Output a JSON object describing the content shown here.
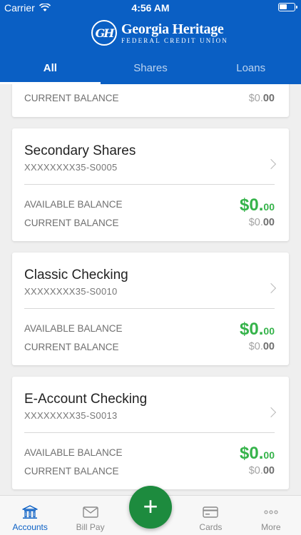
{
  "status": {
    "carrier": "Carrier",
    "time": "4:56 AM"
  },
  "brand": {
    "title": "Georgia Heritage",
    "subtitle": "FEDERAL CREDIT UNION"
  },
  "tabs": [
    {
      "label": "All",
      "active": true
    },
    {
      "label": "Shares",
      "active": false
    },
    {
      "label": "Loans",
      "active": false
    }
  ],
  "accounts": [
    {
      "current_label": "CURRENT BALANCE",
      "current_dollars": "$0.",
      "current_cents": "00"
    },
    {
      "name": "Secondary Shares",
      "number": "XXXXXXXX35-S0005",
      "available_label": "AVAILABLE BALANCE",
      "available_dollars": "$0.",
      "available_cents": "00",
      "current_label": "CURRENT BALANCE",
      "current_dollars": "$0.",
      "current_cents": "00"
    },
    {
      "name": "Classic Checking",
      "number": "XXXXXXXX35-S0010",
      "available_label": "AVAILABLE BALANCE",
      "available_dollars": "$0.",
      "available_cents": "00",
      "current_label": "CURRENT BALANCE",
      "current_dollars": "$0.",
      "current_cents": "00"
    },
    {
      "name": "E-Account Checking",
      "number": "XXXXXXXX35-S0013",
      "available_label": "AVAILABLE BALANCE",
      "available_dollars": "$0.",
      "available_cents": "00",
      "current_label": "CURRENT BALANCE",
      "current_dollars": "$0.",
      "current_cents": "00"
    }
  ],
  "tabbar": [
    {
      "label": "Accounts",
      "icon": "bank-icon",
      "active": true
    },
    {
      "label": "Bill Pay",
      "icon": "envelope-icon",
      "active": false
    },
    {
      "label": "Cards",
      "icon": "card-icon",
      "active": false
    },
    {
      "label": "More",
      "icon": "ellipsis-icon",
      "active": false
    }
  ],
  "fab": {
    "symbol": "+"
  },
  "colors": {
    "brand": "#0a5fc4",
    "positive": "#35b34a",
    "fab": "#1d8b3e"
  }
}
